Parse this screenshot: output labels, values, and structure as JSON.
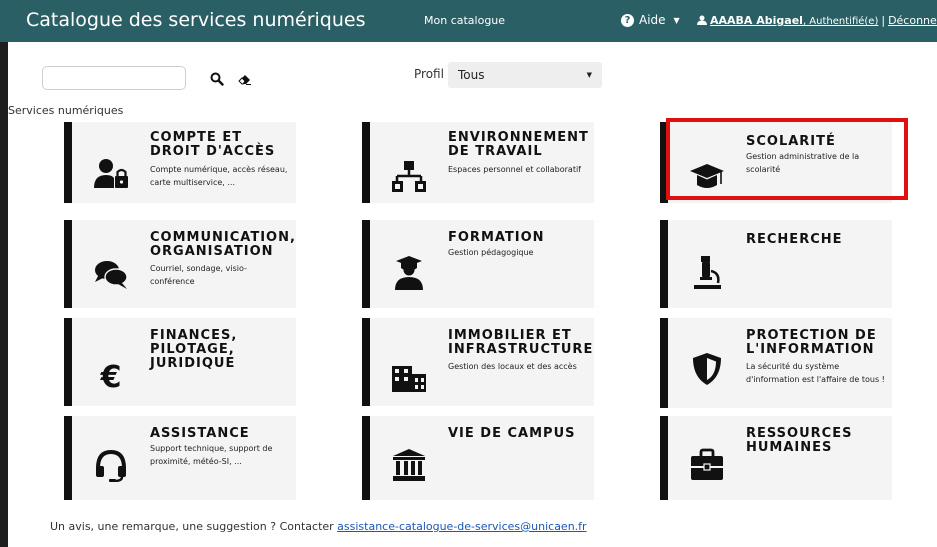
{
  "header": {
    "brand": "Catalogue des services numériques",
    "nav_catalog": "Mon catalogue",
    "help_label": "Aide",
    "user_name": "AAABA Abigael",
    "user_status": ", Authentifié(e)",
    "separator": "|",
    "logout": "Déconnexion"
  },
  "search": {
    "placeholder": "",
    "value": ""
  },
  "profile": {
    "label": "Profil",
    "selected": "Tous"
  },
  "section_title": "Services numériques",
  "cards": [
    {
      "title": "COMPTE ET DROIT D'ACCÈS",
      "desc": "Compte numérique, accès réseau, carte multiservice, ...",
      "icon": "user-lock-icon"
    },
    {
      "title": "ENVIRONNEMENT DE TRAVAIL",
      "desc": "Espaces personnel et collaboratif",
      "icon": "sitemap-icon"
    },
    {
      "title": "SCOLARITÉ",
      "desc": "Gestion administrative de la scolarité",
      "icon": "graduation-cap-icon"
    },
    {
      "title": "COMMUNICATION, ORGANISATION",
      "desc": "Courriel, sondage, visio-conférence",
      "icon": "comments-icon"
    },
    {
      "title": "FORMATION",
      "desc": "Gestion pédagogique",
      "icon": "teacher-icon"
    },
    {
      "title": "RECHERCHE",
      "desc": "",
      "icon": "microscope-icon"
    },
    {
      "title": "FINANCES, PILOTAGE, JURIDIQUE",
      "desc": "",
      "icon": "euro-icon"
    },
    {
      "title": "IMMOBILIER ET INFRASTRUCTURE",
      "desc": "Gestion des locaux et des accès",
      "icon": "building-icon"
    },
    {
      "title": "PROTECTION DE L'INFORMATION",
      "desc": "La sécurité du système d'information est l'affaire de tous !",
      "icon": "shield-icon"
    },
    {
      "title": "ASSISTANCE",
      "desc": "Support technique, support de proximité, météo-SI, ...",
      "icon": "headset-icon"
    },
    {
      "title": "VIE DE CAMPUS",
      "desc": "",
      "icon": "university-icon"
    },
    {
      "title": "RESSOURCES HUMAINES",
      "desc": "",
      "icon": "briefcase-icon"
    }
  ],
  "footer": {
    "text": "Un avis, une remarque, une suggestion ? Contacter ",
    "link": "assistance-catalogue-de-services@unicaen.fr"
  },
  "colors": {
    "topbar": "#2a5f65",
    "highlight": "#e01010",
    "card_bg": "#f4f4f4",
    "link": "#1a57b8"
  }
}
